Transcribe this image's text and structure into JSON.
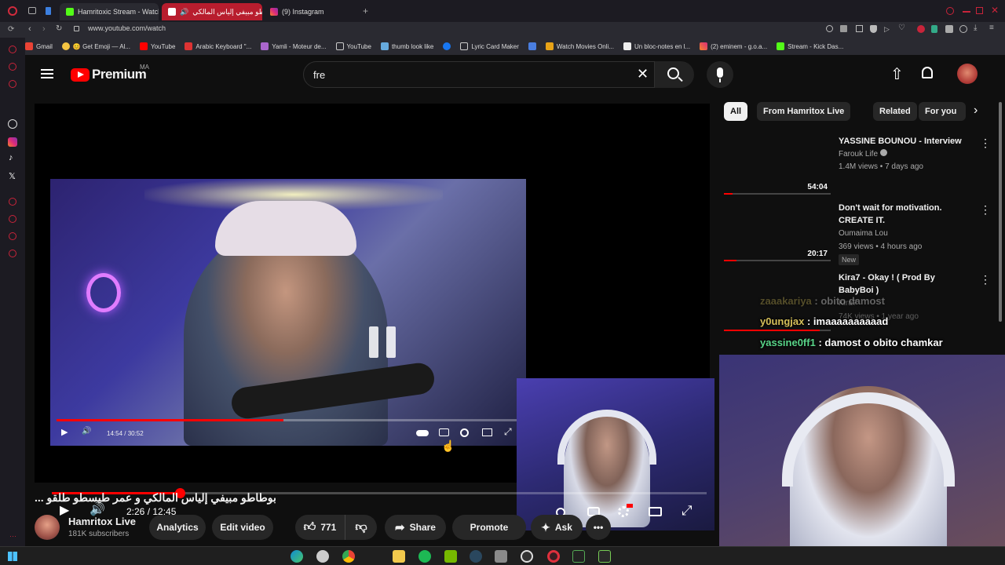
{
  "browser": {
    "tabs": [
      {
        "label": "Hamritoxic Stream - Watch"
      },
      {
        "label": "بوطاطو مبيفي إلياس المالكي"
      },
      {
        "label": "(9) Instagram"
      }
    ],
    "url": "www.youtube.com/watch",
    "bookmarks": [
      {
        "label": "Gmail"
      },
      {
        "label": "😊 Get Emoji — Al..."
      },
      {
        "label": "YouTube"
      },
      {
        "label": "Arabic Keyboard \"..."
      },
      {
        "label": "Yamli - Moteur de..."
      },
      {
        "label": "YouTube"
      },
      {
        "label": "thumb look like"
      },
      {
        "label": "Lyric Card Maker"
      },
      {
        "label": "Watch Movies Onli..."
      },
      {
        "label": "Un bloc-notes en l..."
      },
      {
        "label": "(2) eminem - g.o.a..."
      },
      {
        "label": "Stream - Kick Das..."
      }
    ]
  },
  "youtube": {
    "logo_text": "Premium",
    "logo_region": "MA",
    "search_value": "fre",
    "player": {
      "inner_time": "14:54 / 30:52",
      "inner_progress": 0.49,
      "time": "2:26 / 12:45",
      "progress": 0.195
    },
    "video_title": "بوطاطو مبيفي إلياس المالكي و عمر طيسطو طلقو ...",
    "channel": {
      "name": "Hamritox Live",
      "subscribers": "181K subscribers"
    },
    "actions": {
      "analytics": "Analytics",
      "edit_video": "Edit video",
      "likes": "771",
      "share": "Share",
      "promote": "Promote",
      "ask": "Ask"
    },
    "chips": [
      "All",
      "From Hamritox Live",
      "Related",
      "For you"
    ],
    "recommendations": [
      {
        "title": "YASSINE BOUNOU - Interview",
        "channel": "Farouk Life",
        "meta": "1.4M views • 7 days ago",
        "duration": "54:04",
        "watched": 0.08
      },
      {
        "title": "Don't wait for motivation. CREATE IT.",
        "channel": "Oumaima Lou",
        "meta": "369 views • 4 hours ago",
        "duration": "20:17",
        "badge": "New",
        "watched": 0.12
      },
      {
        "title": "Kira7 - Okay ! ( Prod By BabyBoi )",
        "channel": "Kira7",
        "meta": "74K views • 1 year ago",
        "watched": 0.9
      }
    ],
    "chat": [
      {
        "user": "zaaakariya",
        "message": ": obito damost"
      },
      {
        "user": "y0ungjax",
        "message": ": imaaaaaaaaaad"
      },
      {
        "user": "yassine0ff1",
        "message": ": damost o obito chamkar"
      }
    ]
  }
}
